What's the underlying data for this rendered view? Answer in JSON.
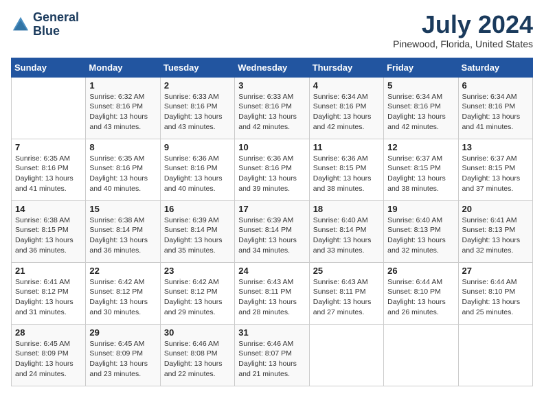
{
  "header": {
    "logo_line1": "General",
    "logo_line2": "Blue",
    "month": "July 2024",
    "location": "Pinewood, Florida, United States"
  },
  "weekdays": [
    "Sunday",
    "Monday",
    "Tuesday",
    "Wednesday",
    "Thursday",
    "Friday",
    "Saturday"
  ],
  "weeks": [
    [
      {
        "day": "",
        "sunrise": "",
        "sunset": "",
        "daylight": ""
      },
      {
        "day": "1",
        "sunrise": "Sunrise: 6:32 AM",
        "sunset": "Sunset: 8:16 PM",
        "daylight": "Daylight: 13 hours and 43 minutes."
      },
      {
        "day": "2",
        "sunrise": "Sunrise: 6:33 AM",
        "sunset": "Sunset: 8:16 PM",
        "daylight": "Daylight: 13 hours and 43 minutes."
      },
      {
        "day": "3",
        "sunrise": "Sunrise: 6:33 AM",
        "sunset": "Sunset: 8:16 PM",
        "daylight": "Daylight: 13 hours and 42 minutes."
      },
      {
        "day": "4",
        "sunrise": "Sunrise: 6:34 AM",
        "sunset": "Sunset: 8:16 PM",
        "daylight": "Daylight: 13 hours and 42 minutes."
      },
      {
        "day": "5",
        "sunrise": "Sunrise: 6:34 AM",
        "sunset": "Sunset: 8:16 PM",
        "daylight": "Daylight: 13 hours and 42 minutes."
      },
      {
        "day": "6",
        "sunrise": "Sunrise: 6:34 AM",
        "sunset": "Sunset: 8:16 PM",
        "daylight": "Daylight: 13 hours and 41 minutes."
      }
    ],
    [
      {
        "day": "7",
        "sunrise": "Sunrise: 6:35 AM",
        "sunset": "Sunset: 8:16 PM",
        "daylight": "Daylight: 13 hours and 41 minutes."
      },
      {
        "day": "8",
        "sunrise": "Sunrise: 6:35 AM",
        "sunset": "Sunset: 8:16 PM",
        "daylight": "Daylight: 13 hours and 40 minutes."
      },
      {
        "day": "9",
        "sunrise": "Sunrise: 6:36 AM",
        "sunset": "Sunset: 8:16 PM",
        "daylight": "Daylight: 13 hours and 40 minutes."
      },
      {
        "day": "10",
        "sunrise": "Sunrise: 6:36 AM",
        "sunset": "Sunset: 8:16 PM",
        "daylight": "Daylight: 13 hours and 39 minutes."
      },
      {
        "day": "11",
        "sunrise": "Sunrise: 6:36 AM",
        "sunset": "Sunset: 8:15 PM",
        "daylight": "Daylight: 13 hours and 38 minutes."
      },
      {
        "day": "12",
        "sunrise": "Sunrise: 6:37 AM",
        "sunset": "Sunset: 8:15 PM",
        "daylight": "Daylight: 13 hours and 38 minutes."
      },
      {
        "day": "13",
        "sunrise": "Sunrise: 6:37 AM",
        "sunset": "Sunset: 8:15 PM",
        "daylight": "Daylight: 13 hours and 37 minutes."
      }
    ],
    [
      {
        "day": "14",
        "sunrise": "Sunrise: 6:38 AM",
        "sunset": "Sunset: 8:15 PM",
        "daylight": "Daylight: 13 hours and 36 minutes."
      },
      {
        "day": "15",
        "sunrise": "Sunrise: 6:38 AM",
        "sunset": "Sunset: 8:14 PM",
        "daylight": "Daylight: 13 hours and 36 minutes."
      },
      {
        "day": "16",
        "sunrise": "Sunrise: 6:39 AM",
        "sunset": "Sunset: 8:14 PM",
        "daylight": "Daylight: 13 hours and 35 minutes."
      },
      {
        "day": "17",
        "sunrise": "Sunrise: 6:39 AM",
        "sunset": "Sunset: 8:14 PM",
        "daylight": "Daylight: 13 hours and 34 minutes."
      },
      {
        "day": "18",
        "sunrise": "Sunrise: 6:40 AM",
        "sunset": "Sunset: 8:14 PM",
        "daylight": "Daylight: 13 hours and 33 minutes."
      },
      {
        "day": "19",
        "sunrise": "Sunrise: 6:40 AM",
        "sunset": "Sunset: 8:13 PM",
        "daylight": "Daylight: 13 hours and 32 minutes."
      },
      {
        "day": "20",
        "sunrise": "Sunrise: 6:41 AM",
        "sunset": "Sunset: 8:13 PM",
        "daylight": "Daylight: 13 hours and 32 minutes."
      }
    ],
    [
      {
        "day": "21",
        "sunrise": "Sunrise: 6:41 AM",
        "sunset": "Sunset: 8:12 PM",
        "daylight": "Daylight: 13 hours and 31 minutes."
      },
      {
        "day": "22",
        "sunrise": "Sunrise: 6:42 AM",
        "sunset": "Sunset: 8:12 PM",
        "daylight": "Daylight: 13 hours and 30 minutes."
      },
      {
        "day": "23",
        "sunrise": "Sunrise: 6:42 AM",
        "sunset": "Sunset: 8:12 PM",
        "daylight": "Daylight: 13 hours and 29 minutes."
      },
      {
        "day": "24",
        "sunrise": "Sunrise: 6:43 AM",
        "sunset": "Sunset: 8:11 PM",
        "daylight": "Daylight: 13 hours and 28 minutes."
      },
      {
        "day": "25",
        "sunrise": "Sunrise: 6:43 AM",
        "sunset": "Sunset: 8:11 PM",
        "daylight": "Daylight: 13 hours and 27 minutes."
      },
      {
        "day": "26",
        "sunrise": "Sunrise: 6:44 AM",
        "sunset": "Sunset: 8:10 PM",
        "daylight": "Daylight: 13 hours and 26 minutes."
      },
      {
        "day": "27",
        "sunrise": "Sunrise: 6:44 AM",
        "sunset": "Sunset: 8:10 PM",
        "daylight": "Daylight: 13 hours and 25 minutes."
      }
    ],
    [
      {
        "day": "28",
        "sunrise": "Sunrise: 6:45 AM",
        "sunset": "Sunset: 8:09 PM",
        "daylight": "Daylight: 13 hours and 24 minutes."
      },
      {
        "day": "29",
        "sunrise": "Sunrise: 6:45 AM",
        "sunset": "Sunset: 8:09 PM",
        "daylight": "Daylight: 13 hours and 23 minutes."
      },
      {
        "day": "30",
        "sunrise": "Sunrise: 6:46 AM",
        "sunset": "Sunset: 8:08 PM",
        "daylight": "Daylight: 13 hours and 22 minutes."
      },
      {
        "day": "31",
        "sunrise": "Sunrise: 6:46 AM",
        "sunset": "Sunset: 8:07 PM",
        "daylight": "Daylight: 13 hours and 21 minutes."
      },
      {
        "day": "",
        "sunrise": "",
        "sunset": "",
        "daylight": ""
      },
      {
        "day": "",
        "sunrise": "",
        "sunset": "",
        "daylight": ""
      },
      {
        "day": "",
        "sunrise": "",
        "sunset": "",
        "daylight": ""
      }
    ]
  ]
}
